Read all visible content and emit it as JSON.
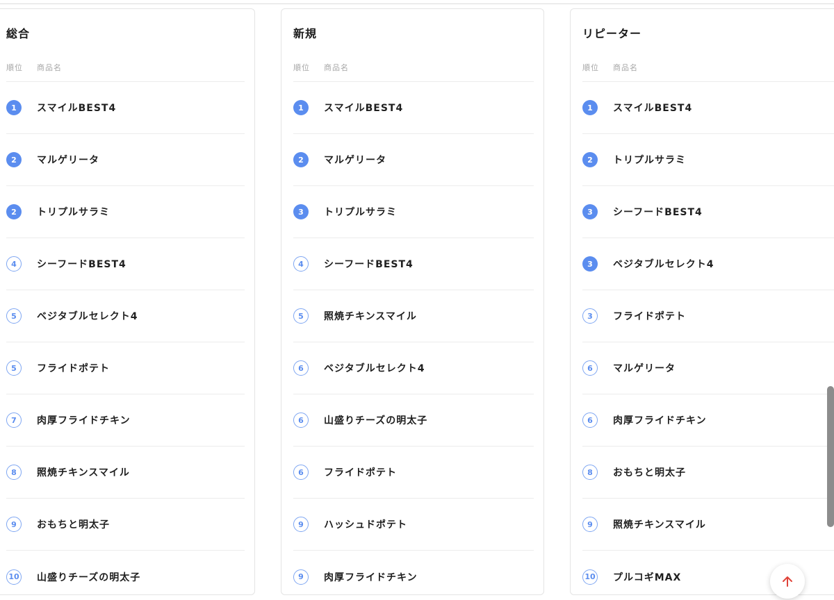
{
  "columns": {
    "rank": "順位",
    "name": "商品名"
  },
  "panels": [
    {
      "title": "総合",
      "rows": [
        {
          "rank": "1",
          "name": "スマイルBEST4",
          "top": true
        },
        {
          "rank": "2",
          "name": "マルゲリータ",
          "top": true
        },
        {
          "rank": "2",
          "name": "トリプルサラミ",
          "top": true
        },
        {
          "rank": "4",
          "name": "シーフードBEST4",
          "top": false
        },
        {
          "rank": "5",
          "name": "ベジタブルセレクト4",
          "top": false
        },
        {
          "rank": "5",
          "name": "フライドポテト",
          "top": false
        },
        {
          "rank": "7",
          "name": "肉厚フライドチキン",
          "top": false
        },
        {
          "rank": "8",
          "name": "照焼チキンスマイル",
          "top": false
        },
        {
          "rank": "9",
          "name": "おもちと明太子",
          "top": false
        },
        {
          "rank": "10",
          "name": "山盛りチーズの明太子",
          "top": false
        }
      ]
    },
    {
      "title": "新規",
      "rows": [
        {
          "rank": "1",
          "name": "スマイルBEST4",
          "top": true
        },
        {
          "rank": "2",
          "name": "マルゲリータ",
          "top": true
        },
        {
          "rank": "3",
          "name": "トリプルサラミ",
          "top": true
        },
        {
          "rank": "4",
          "name": "シーフードBEST4",
          "top": false
        },
        {
          "rank": "5",
          "name": "照焼チキンスマイル",
          "top": false
        },
        {
          "rank": "6",
          "name": "ベジタブルセレクト4",
          "top": false
        },
        {
          "rank": "6",
          "name": "山盛りチーズの明太子",
          "top": false
        },
        {
          "rank": "6",
          "name": "フライドポテト",
          "top": false
        },
        {
          "rank": "9",
          "name": "ハッシュドポテト",
          "top": false
        },
        {
          "rank": "9",
          "name": "肉厚フライドチキン",
          "top": false
        }
      ]
    },
    {
      "title": "リピーター",
      "rows": [
        {
          "rank": "1",
          "name": "スマイルBEST4",
          "top": true
        },
        {
          "rank": "2",
          "name": "トリプルサラミ",
          "top": true
        },
        {
          "rank": "3",
          "name": "シーフードBEST4",
          "top": true
        },
        {
          "rank": "3",
          "name": "ベジタブルセレクト4",
          "top": true
        },
        {
          "rank": "3",
          "name": "フライドポテト",
          "top": false
        },
        {
          "rank": "6",
          "name": "マルゲリータ",
          "top": false
        },
        {
          "rank": "6",
          "name": "肉厚フライドチキン",
          "top": false
        },
        {
          "rank": "8",
          "name": "おもちと明太子",
          "top": false
        },
        {
          "rank": "9",
          "name": "照焼チキンスマイル",
          "top": false
        },
        {
          "rank": "10",
          "name": "プルコギMAX",
          "top": false
        }
      ]
    }
  ],
  "icons": {
    "back_to_top": "arrow-up-icon"
  },
  "colors": {
    "badge_fill": "#5b8def",
    "badge_outline": "#7ea6f2",
    "arrow": "#e0443a"
  }
}
